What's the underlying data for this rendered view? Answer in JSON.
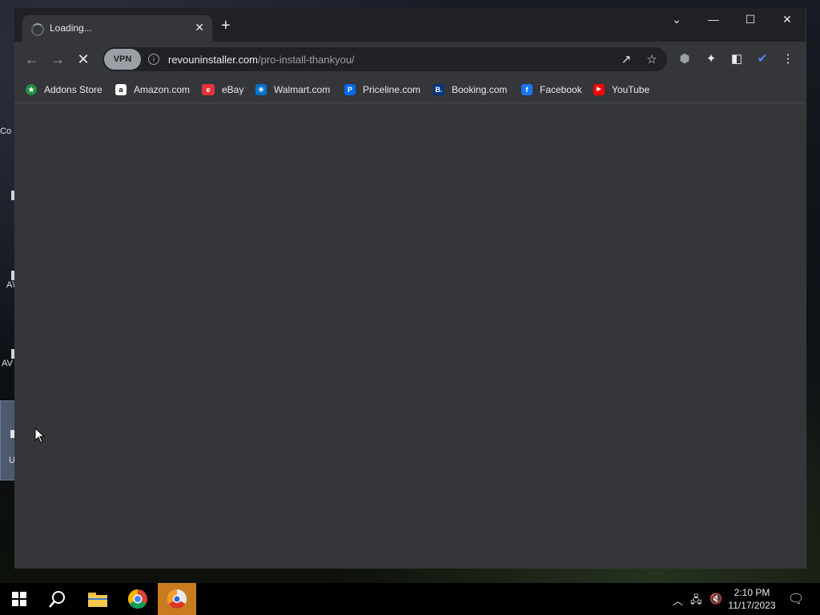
{
  "desktop": {
    "icon_labels": [
      "Co",
      "",
      "A\\",
      "AV",
      "U"
    ]
  },
  "browser": {
    "tab": {
      "title": "Loading...",
      "close": "✕"
    },
    "new_tab": "+",
    "window_controls": {
      "tab_search": "⌄",
      "minimize": "—",
      "maximize": "☐",
      "close": "✕"
    },
    "nav": {
      "back": "←",
      "forward": "→",
      "stop": "✕"
    },
    "omnibox": {
      "vpn_label": "VPN",
      "url_host": "revouninstaller.com",
      "url_path": "/pro-install-thankyou/"
    },
    "bookmarks": [
      {
        "label": "Addons Store",
        "icon": "★",
        "color": "#1e8e3e"
      },
      {
        "label": "Amazon.com",
        "icon": "a",
        "color": "#ffffff"
      },
      {
        "label": "eBay",
        "icon": "e",
        "color": "#e53238"
      },
      {
        "label": "Walmart.com",
        "icon": "✳",
        "color": "#0071ce"
      },
      {
        "label": "Priceline.com",
        "icon": "P",
        "color": "#0068ef"
      },
      {
        "label": "Booking.com",
        "icon": "B.",
        "color": "#003580"
      },
      {
        "label": "Facebook",
        "icon": "f",
        "color": "#1877f2"
      },
      {
        "label": "YouTube",
        "icon": "▶",
        "color": "#ff0000"
      }
    ]
  },
  "taskbar": {
    "time": "2:10 PM",
    "date": "11/17/2023"
  }
}
